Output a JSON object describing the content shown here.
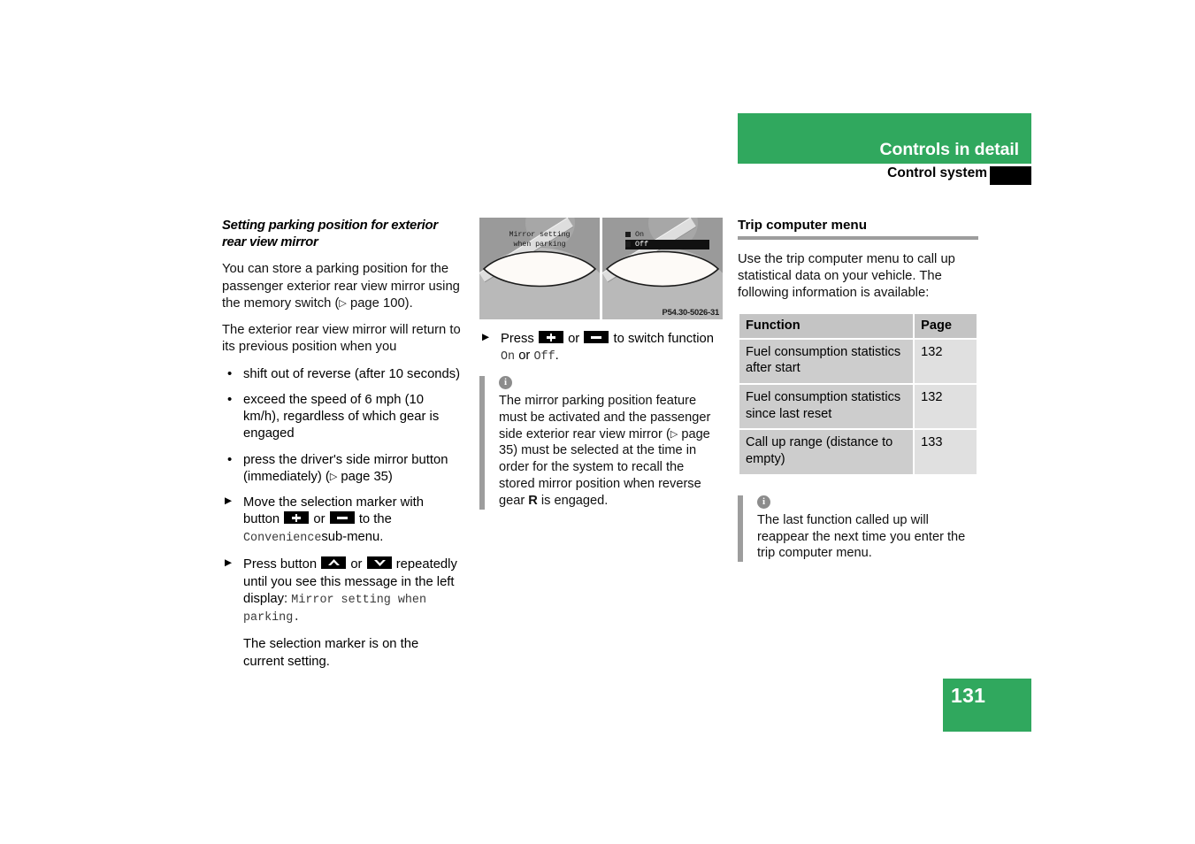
{
  "header": {
    "title": "Controls in detail",
    "subtitle": "Control system",
    "green": "#30a85e"
  },
  "page_number": "131",
  "left_column": {
    "subheading": "Setting parking position for exterior rear view mirror",
    "para1_a": "You can store a parking position for the passenger exterior rear view mirror using the memory switch (",
    "para1_ref": " page 100).",
    "para2": "The exterior rear view mirror will return to its previous position when you",
    "bullets": [
      "shift out of reverse (after 10 seconds)",
      "exceed the speed of 6 mph (10 km/h), regardless of which gear is engaged",
      "press the driver's side mirror button (immediately) ("
    ],
    "bullet3_ref": " page 35)",
    "step1_a": "Move the selection marker with button",
    "step1_or": "or",
    "step1_b": "to the",
    "step1_mono": "Convenience",
    "step1_c": "sub-menu.",
    "step2_a": "Press button",
    "step2_or": "or",
    "step2_b": "repeatedly until you see this message in the left display:",
    "step2_mono": "Mirror setting when parking.",
    "step3": "The selection marker is on the current setting."
  },
  "middle_column": {
    "figure": {
      "left_display_line1": "Mirror setting",
      "left_display_line2": "when parking",
      "right_display_option1": "On",
      "right_display_option2": "Off",
      "caption": "P54.30-5026-31"
    },
    "step_a": "Press",
    "step_or": "or",
    "step_b": "to switch function",
    "step_mono_on": "On",
    "step_mid_or": "or",
    "step_mono_off": "Off",
    "step_period": ".",
    "note": {
      "icon": "info-icon",
      "text_a": "The mirror parking position feature must be activated and the passenger side exterior rear view mirror (",
      "text_ref": " page 35) must be selected at the time in order for the system to recall the stored mirror position when reverse gear ",
      "gear": "R",
      "text_c": " is engaged."
    }
  },
  "right_column": {
    "heading": "Trip computer menu",
    "intro": "Use the trip computer menu to call up statistical data on your vehicle. The following information is available:",
    "table": {
      "headers": [
        "Function",
        "Page"
      ],
      "rows": [
        [
          "Fuel consumption statistics after start",
          "132"
        ],
        [
          "Fuel consumption statistics since last reset",
          "132"
        ],
        [
          "Call up range (distance to empty)",
          "133"
        ]
      ]
    },
    "note": {
      "icon": "info-icon",
      "text": "The last function called up will reappear the next time you enter the trip computer menu."
    }
  }
}
